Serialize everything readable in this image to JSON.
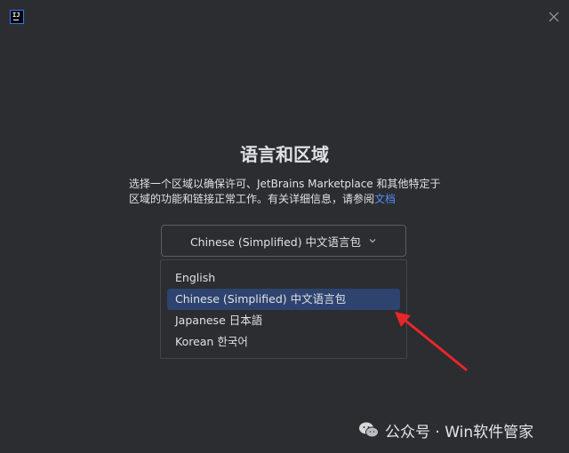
{
  "app_logo": {
    "text": "IJ"
  },
  "title": "语言和区域",
  "description": {
    "text": "选择一个区域以确保许可、JetBrains Marketplace 和其他特定于区域的功能和链接正常工作。有关详细信息，请参阅",
    "link": "文档"
  },
  "language_select": {
    "value": "Chinese (Simplified) 中文语言包",
    "options": [
      {
        "label": "English",
        "selected": false
      },
      {
        "label": "Chinese (Simplified) 中文语言包",
        "selected": true
      },
      {
        "label": "Japanese 日本語",
        "selected": false
      },
      {
        "label": "Korean 한국어",
        "selected": false
      }
    ]
  },
  "annotation_arrow": {
    "color": "#e8262a"
  },
  "watermark": {
    "text": "公众号 · Win软件管家"
  },
  "colors": {
    "background": "#2b2d30",
    "text": "#dfe1e5",
    "link": "#548af7",
    "selected_option": "#2e436e",
    "select_border": "#5a5d63"
  }
}
